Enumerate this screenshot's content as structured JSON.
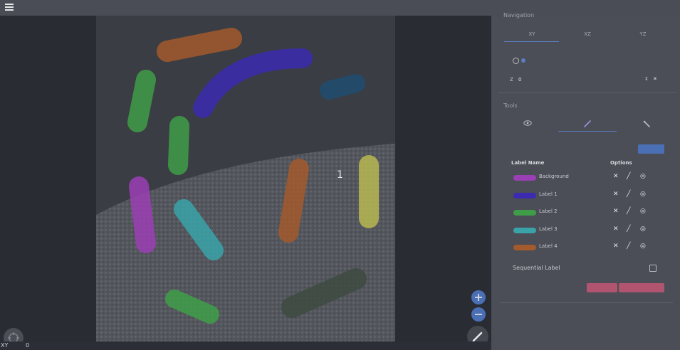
{
  "header": {
    "menu_icon": "hamburger-menu-icon"
  },
  "canvas": {
    "cursor_label": "1"
  },
  "statusbar": {
    "view": "XY",
    "slice": "0"
  },
  "navigation": {
    "title": "Navigation",
    "tabs": [
      {
        "label": "XY"
      },
      {
        "label": "XZ"
      },
      {
        "label": "YZ"
      }
    ],
    "slice_label": "Z",
    "slice_value": "0"
  },
  "tools": {
    "title": "Tools"
  },
  "labels": {
    "header_name": "Label Name",
    "header_options": "Options",
    "items": [
      {
        "name": "Background",
        "color": "#9b3fb5"
      },
      {
        "name": "Label 1",
        "color": "#3a2bb0"
      },
      {
        "name": "Label 2",
        "color": "#3f9d48"
      },
      {
        "name": "Label 3",
        "color": "#39a3a8"
      },
      {
        "name": "Label 4",
        "color": "#a35a2d"
      }
    ]
  },
  "sequential_label": "Sequential Label",
  "colors": {
    "accent": "#4a6fb5",
    "danger": "#b0546f"
  }
}
